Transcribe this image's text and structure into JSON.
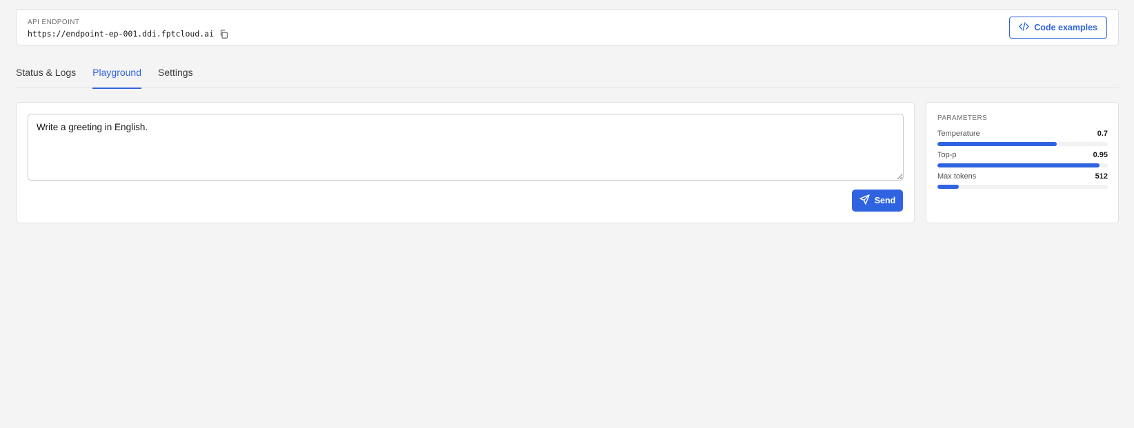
{
  "endpoint": {
    "label": "API ENDPOINT",
    "url": "https://endpoint-ep-001.ddi.fptcloud.ai",
    "copy_icon": "copy-icon"
  },
  "code_button": {
    "label": "Code examples",
    "icon": "code-icon"
  },
  "tabs": [
    {
      "label": "Status & Logs",
      "active": false
    },
    {
      "label": "Playground",
      "active": true
    },
    {
      "label": "Settings",
      "active": false
    }
  ],
  "prompt": {
    "value": "Write a greeting in English."
  },
  "send_button": {
    "label": "Send",
    "icon": "send-icon"
  },
  "parameters": {
    "title": "PARAMETERS",
    "items": [
      {
        "label": "Temperature",
        "value": "0.7",
        "fill": 0.7
      },
      {
        "label": "Top-p",
        "value": "0.95",
        "fill": 0.95
      },
      {
        "label": "Max tokens",
        "value": "512",
        "fill": 0.125
      }
    ]
  },
  "colors": {
    "accent": "#2f63e0",
    "background": "#f4f4f4",
    "card": "#ffffff",
    "border": "#e0e0e0"
  }
}
